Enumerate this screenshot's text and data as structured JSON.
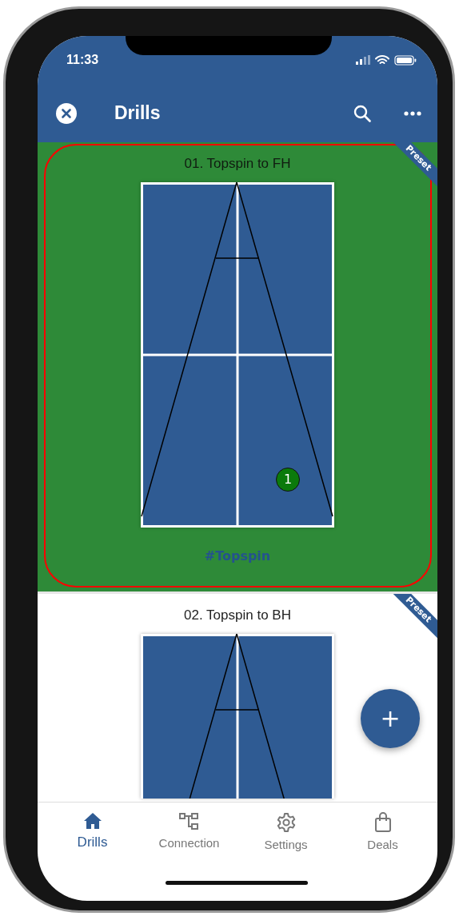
{
  "status_bar": {
    "time": "11:33"
  },
  "app_bar": {
    "title": "Drills"
  },
  "drills": [
    {
      "title": "01. Topspin to FH",
      "badge": "Preset",
      "tag": "#Topspin",
      "ball": "1",
      "selected": true
    },
    {
      "title": "02. Topspin to BH",
      "badge": "Preset",
      "selected": false
    }
  ],
  "fab": {
    "label": "+"
  },
  "nav": [
    {
      "kind": "home",
      "label": "Drills",
      "selected": true
    },
    {
      "kind": "connection",
      "label": "Connection",
      "selected": false
    },
    {
      "kind": "settings",
      "label": "Settings",
      "selected": false
    },
    {
      "kind": "deals",
      "label": "Deals",
      "selected": false
    }
  ]
}
